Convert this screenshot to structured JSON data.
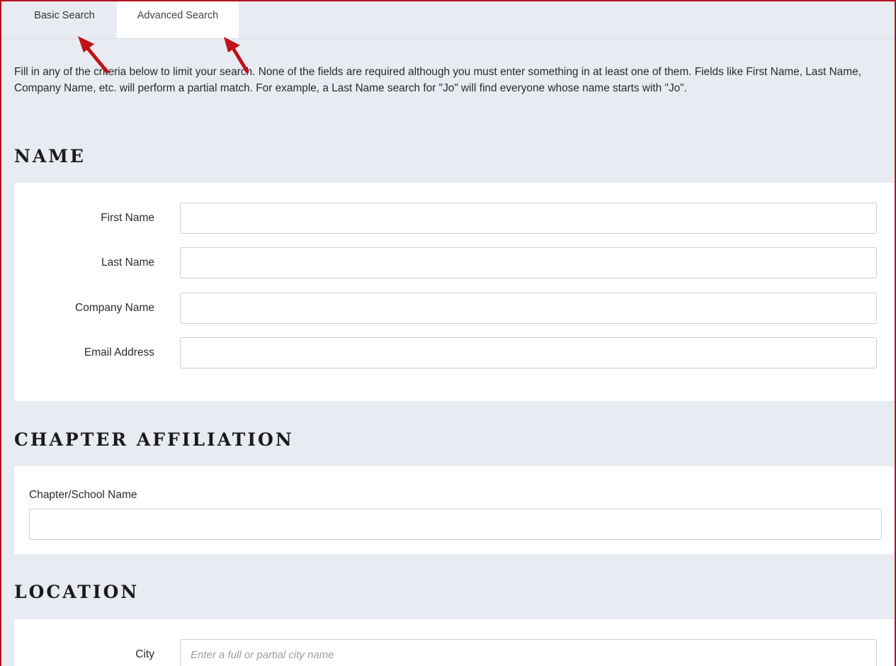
{
  "tabs": {
    "basic": "Basic Search",
    "advanced": "Advanced Search"
  },
  "intro": "Fill in any of the criteria below to limit your search. None of the fields are required although you must enter something in at least one of them. Fields like First Name, Last Name, Company Name, etc. will perform a partial match. For example, a Last Name search for \"Jo\" will find everyone whose name starts with \"Jo\".",
  "sections": {
    "name": {
      "heading": "NAME",
      "first_name_label": "First Name",
      "first_name_value": "",
      "last_name_label": "Last Name",
      "last_name_value": "",
      "company_label": "Company Name",
      "company_value": "",
      "email_label": "Email Address",
      "email_value": ""
    },
    "chapter": {
      "heading": "CHAPTER AFFILIATION",
      "chapter_label": "Chapter/School Name",
      "chapter_value": ""
    },
    "location": {
      "heading": "LOCATION",
      "city_label": "City",
      "city_placeholder": "Enter a full or partial city name",
      "city_value": ""
    }
  },
  "colors": {
    "frame_border": "#b3131b",
    "annotation_arrow": "#c0121a",
    "page_background": "#e8ebf1"
  },
  "annotations": {
    "arrow_icons": [
      "arrow-pointing-to-basic-search-tab",
      "arrow-pointing-to-advanced-search-tab"
    ]
  }
}
